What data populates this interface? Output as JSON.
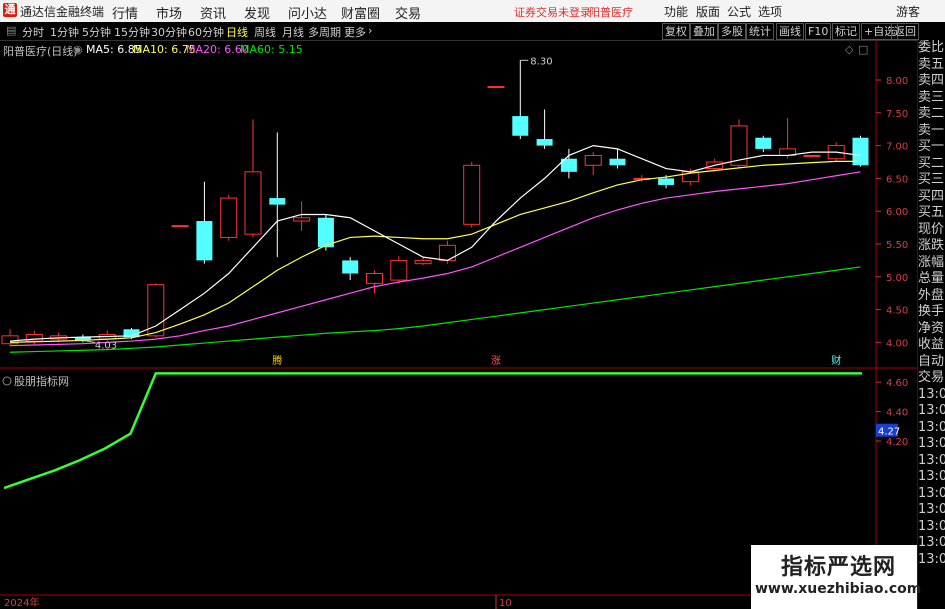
{
  "app": {
    "title": "通达信金融终端",
    "logo": "通"
  },
  "menus": [
    "行情",
    "市场",
    "资讯",
    "发现",
    "问小达",
    "财富圈",
    "交易"
  ],
  "warning": "证券交易未登录",
  "stock_name": "阳普医疗",
  "top_right": [
    "功能",
    "版面",
    "公式",
    "选项"
  ],
  "guest": "游客",
  "timeframes": [
    "分时",
    "1分钟",
    "5分钟",
    "15分钟",
    "30分钟",
    "60分钟",
    "日线",
    "周线",
    "月线",
    "多周期",
    "更多"
  ],
  "active_timeframe": "日线",
  "toolbar_right": [
    "复权",
    "叠加",
    "多股",
    "统计",
    "画线",
    "F10",
    "标记",
    "+自选",
    "返回"
  ],
  "legend": {
    "title": "阳普医疗(日线)",
    "ma5": "MA5: 6.85",
    "ma10": "MA10: 6.75",
    "ma20": "MA20: 6.60",
    "ma60": "MA60: 5.15"
  },
  "colors": {
    "up": "#ff3232",
    "down": "#54ffff",
    "ma5": "#ffffff",
    "ma10": "#ffff54",
    "ma20": "#ff54ff",
    "ma60": "#00e600",
    "indicator": "#33ff33"
  },
  "price_axis": [
    "8.00",
    "7.50",
    "7.00",
    "6.50",
    "6.00",
    "5.50",
    "5.00",
    "4.50",
    "4.00"
  ],
  "high_label": "8.30",
  "low_label": "4.03",
  "markers": [
    "腾",
    "涨",
    "财"
  ],
  "indicator_title": "股朋指标网",
  "ind_axis": [
    "4.60",
    "4.40",
    "4.20"
  ],
  "ind_current": "4.27",
  "x_labels": [
    "2024年",
    "10"
  ],
  "right_panel": [
    "委比",
    "卖五",
    "卖四",
    "卖三",
    "卖二",
    "卖一",
    "买一",
    "买二",
    "买三",
    "买四",
    "买五",
    "现价",
    "涨跌",
    "涨幅",
    "总量",
    "外盘",
    "换手",
    "净资",
    "收益",
    "自动",
    "交易",
    "13:05",
    "13:05",
    "13:05",
    "13:05",
    "13:05",
    "13:05",
    "13:05",
    "13:05",
    "13:05",
    "13:05",
    "13:05"
  ],
  "watermark": {
    "title": "指标严选网",
    "url": "www.xuezhibiao.com"
  },
  "candles": [
    [
      3.98,
      4.1,
      4.2,
      3.95
    ],
    [
      4.02,
      4.12,
      4.18,
      3.97
    ],
    [
      4.05,
      4.1,
      4.15,
      4.0
    ],
    [
      4.08,
      4.03,
      4.12,
      4.0
    ],
    [
      4.05,
      4.12,
      4.18,
      4.03
    ],
    [
      4.2,
      4.08,
      4.22,
      4.05
    ],
    [
      4.1,
      4.88,
      4.9,
      4.08
    ],
    [
      5.78,
      5.78,
      5.78,
      5.78
    ],
    [
      5.85,
      5.25,
      6.45,
      5.2
    ],
    [
      5.6,
      6.2,
      6.25,
      5.55
    ],
    [
      5.65,
      6.6,
      7.4,
      5.6
    ],
    [
      6.2,
      6.1,
      7.2,
      5.3
    ],
    [
      5.85,
      5.9,
      6.15,
      5.7
    ],
    [
      5.9,
      5.45,
      5.95,
      5.4
    ],
    [
      5.25,
      5.05,
      5.3,
      4.95
    ],
    [
      4.9,
      5.05,
      5.1,
      4.75
    ],
    [
      4.95,
      5.25,
      5.32,
      4.9
    ],
    [
      5.2,
      5.25,
      5.3,
      5.18
    ],
    [
      5.25,
      5.48,
      5.55,
      5.2
    ],
    [
      5.8,
      6.7,
      6.75,
      5.75
    ],
    [
      7.9,
      7.9,
      7.9,
      7.9
    ],
    [
      7.45,
      7.15,
      8.3,
      7.1
    ],
    [
      7.1,
      7.0,
      7.55,
      6.95
    ],
    [
      6.8,
      6.6,
      6.95,
      6.5
    ],
    [
      6.7,
      6.85,
      6.9,
      6.55
    ],
    [
      6.8,
      6.7,
      6.95,
      6.65
    ],
    [
      6.5,
      6.5,
      6.55,
      6.45
    ],
    [
      6.5,
      6.4,
      6.55,
      6.35
    ],
    [
      6.45,
      6.6,
      6.65,
      6.4
    ],
    [
      6.65,
      6.75,
      6.8,
      6.6
    ],
    [
      6.7,
      7.3,
      7.4,
      6.65
    ],
    [
      7.12,
      6.95,
      7.15,
      6.9
    ],
    [
      6.85,
      6.95,
      7.42,
      6.8
    ],
    [
      6.85,
      6.85,
      6.85,
      6.85
    ],
    [
      6.8,
      7.0,
      7.05,
      6.75
    ],
    [
      7.12,
      6.7,
      7.15,
      6.68
    ]
  ],
  "ma5": [
    4.02,
    4.05,
    4.07,
    4.08,
    4.09,
    4.1,
    4.25,
    4.5,
    4.75,
    5.05,
    5.45,
    5.85,
    5.95,
    5.95,
    5.9,
    5.7,
    5.5,
    5.3,
    5.25,
    5.45,
    5.85,
    6.2,
    6.5,
    6.85,
    7.0,
    6.95,
    6.8,
    6.65,
    6.6,
    6.7,
    6.78,
    6.85,
    6.85,
    6.9,
    6.9,
    6.85
  ],
  "ma10": [
    4.0,
    4.01,
    4.02,
    4.03,
    4.05,
    4.07,
    4.15,
    4.28,
    4.42,
    4.6,
    4.85,
    5.1,
    5.3,
    5.48,
    5.6,
    5.62,
    5.6,
    5.58,
    5.58,
    5.65,
    5.8,
    5.95,
    6.05,
    6.15,
    6.28,
    6.4,
    6.48,
    6.52,
    6.58,
    6.62,
    6.66,
    6.7,
    6.72,
    6.74,
    6.76,
    6.76
  ],
  "ma20": [
    3.95,
    3.96,
    3.97,
    3.98,
    4.0,
    4.02,
    4.05,
    4.1,
    4.18,
    4.25,
    4.35,
    4.45,
    4.55,
    4.65,
    4.75,
    4.85,
    4.92,
    4.98,
    5.05,
    5.15,
    5.3,
    5.45,
    5.6,
    5.75,
    5.9,
    6.02,
    6.12,
    6.2,
    6.25,
    6.3,
    6.34,
    6.38,
    6.42,
    6.48,
    6.54,
    6.6
  ],
  "ma60": [
    3.85,
    3.86,
    3.87,
    3.88,
    3.89,
    3.91,
    3.93,
    3.96,
    3.99,
    4.02,
    4.05,
    4.08,
    4.11,
    4.14,
    4.16,
    4.18,
    4.21,
    4.25,
    4.3,
    4.35,
    4.4,
    4.45,
    4.5,
    4.55,
    4.6,
    4.65,
    4.7,
    4.75,
    4.8,
    4.85,
    4.9,
    4.95,
    5.0,
    5.05,
    5.1,
    5.15
  ],
  "indicator": [
    3.88,
    3.94,
    4.0,
    4.07,
    4.15,
    4.25,
    4.66,
    4.66,
    4.66,
    4.66,
    4.66,
    4.66,
    4.66,
    4.66,
    4.66,
    4.66,
    4.66,
    4.66,
    4.66,
    4.66,
    4.66,
    4.66,
    4.66,
    4.66,
    4.66,
    4.66,
    4.66,
    4.66,
    4.66,
    4.66,
    4.66,
    4.66,
    4.66,
    4.66,
    4.66,
    4.66
  ]
}
